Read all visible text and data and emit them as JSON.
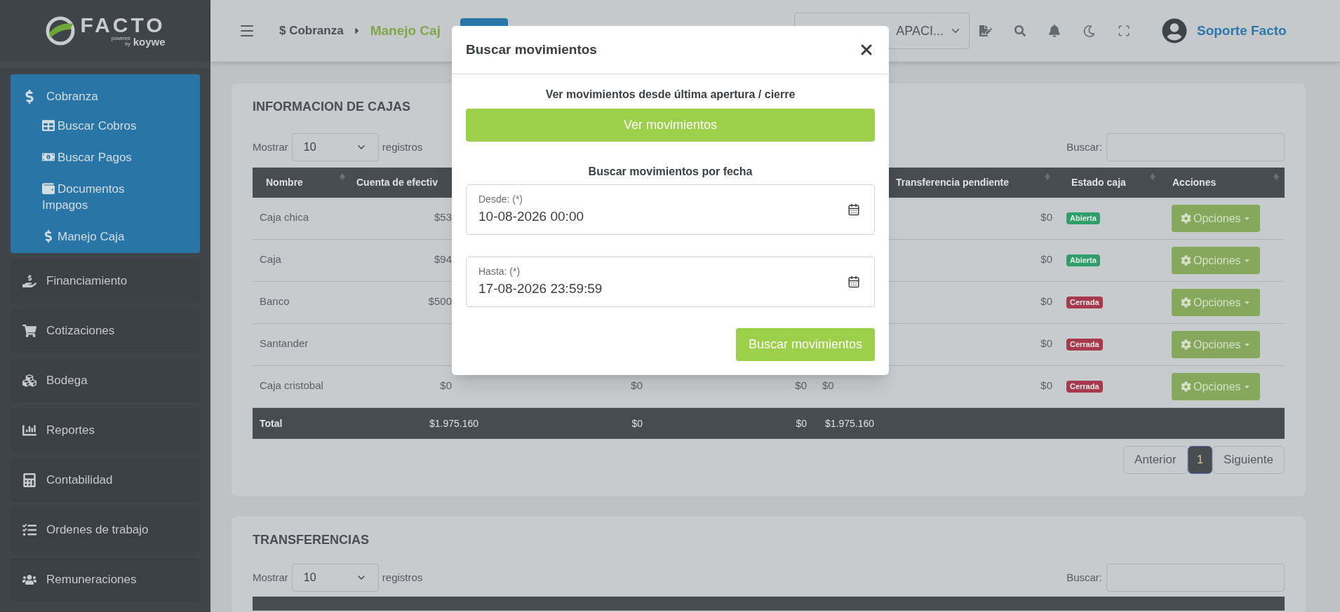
{
  "brand": {
    "name": "FACTO",
    "powered": "powered",
    "by": "by",
    "partner": "koywe"
  },
  "sidebar": {
    "items": [
      {
        "label": "Cobranza",
        "selected": true,
        "children": [
          {
            "label": "Buscar Cobros"
          },
          {
            "label": "Buscar Pagos"
          },
          {
            "label": "Documentos Impagos"
          },
          {
            "label": "Manejo Caja"
          }
        ]
      },
      {
        "label": "Financiamiento",
        "selected": false
      },
      {
        "label": "Cotizaciones",
        "selected": false
      },
      {
        "label": "Bodega",
        "selected": false
      },
      {
        "label": "Reportes",
        "selected": false
      },
      {
        "label": "Contabilidad",
        "selected": false
      },
      {
        "label": "Ordenes de trabajo",
        "selected": false
      },
      {
        "label": "Remuneraciones",
        "selected": false
      }
    ]
  },
  "topbar": {
    "breadcrumb": [
      "$ Cobranza",
      "Manejo Caj"
    ],
    "company_select": "APACI...",
    "user": "Soporte Facto"
  },
  "cajas": {
    "title": "INFORMACION DE CAJAS",
    "length": {
      "before": "Mostrar",
      "value": "10",
      "after": "registros"
    },
    "search_label": "Buscar:",
    "columns": [
      "Nombre",
      "Cuenta de efectiv",
      "Transferencia pendiente",
      "Estado caja",
      "Acciones"
    ],
    "rows": [
      {
        "name": "Caja chica",
        "column_2": "$53",
        "transferencia_pendiente": "$0",
        "estado": {
          "label": "Abierta",
          "color": "#2e9f6a"
        },
        "action": "Opciones"
      },
      {
        "name": "Caja",
        "column_2": "$94",
        "transferencia_pendiente": "$0",
        "estado": {
          "label": "Abierta",
          "color": "#2e9f6a"
        },
        "action": "Opciones"
      },
      {
        "name": "Banco",
        "column_2": "$500",
        "transferencia_pendiente": "$0",
        "estado": {
          "label": "Cerrada",
          "color": "#a8394d"
        },
        "action": "Opciones"
      },
      {
        "name": "Santander",
        "transferencia_pendiente": "$0",
        "estado": {
          "label": "Cerrada",
          "color": "#a8394d"
        },
        "action": "Opciones"
      },
      {
        "name": "Caja cristobal",
        "column_2": "$0",
        "column_3": "$0",
        "column_4": "$0",
        "column_5": "$0",
        "transferencia_pendiente": "$0",
        "estado": {
          "label": "Cerrada",
          "color": "#a8394d"
        },
        "action": "Opciones"
      }
    ],
    "total": {
      "label": "Total",
      "column_2": "$1.975.160",
      "column_3": "$0",
      "column_4": "$0",
      "column_5": "$1.975.160"
    },
    "pagination": [
      {
        "label": "Anterior",
        "selected": false
      },
      {
        "label": "1",
        "selected": true
      },
      {
        "label": "Siguiente",
        "selected": false
      }
    ]
  },
  "transferencias": {
    "title": "TRANSFERENCIAS",
    "length": {
      "before": "Mostrar",
      "value": "10",
      "after": "registros"
    },
    "search_label": "Buscar:"
  },
  "modal": {
    "title": "Buscar movimientos",
    "section_1": "Ver movimientos desde última apertura / cierre",
    "button_1": "Ver movimientos",
    "section_2": "Buscar movimientos por fecha",
    "fields": [
      {
        "label": "Desde: (*)",
        "value": "10-08-2026 00:00"
      },
      {
        "label": "Hasta: (*)",
        "value": "17-08-2026 23:59:59"
      }
    ],
    "submit": "Buscar movimientos"
  }
}
